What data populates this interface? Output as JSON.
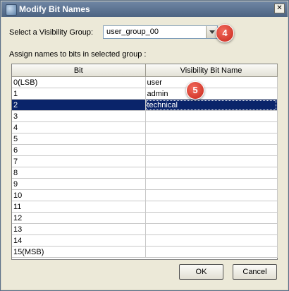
{
  "window": {
    "title": "Modify Bit Names",
    "close_glyph": "✕"
  },
  "group": {
    "label": "Select a Visibility Group:",
    "selected": "user_group_00"
  },
  "assign_label": "Assign names to bits in selected group :",
  "table": {
    "columns": [
      "Bit",
      "Visibility Bit Name"
    ],
    "rows": [
      {
        "bit": "0(LSB)",
        "name": "user"
      },
      {
        "bit": "1",
        "name": "admin"
      },
      {
        "bit": "2",
        "name": "technical"
      },
      {
        "bit": "3",
        "name": ""
      },
      {
        "bit": "4",
        "name": ""
      },
      {
        "bit": "5",
        "name": ""
      },
      {
        "bit": "6",
        "name": ""
      },
      {
        "bit": "7",
        "name": ""
      },
      {
        "bit": "8",
        "name": ""
      },
      {
        "bit": "9",
        "name": ""
      },
      {
        "bit": "10",
        "name": ""
      },
      {
        "bit": "11",
        "name": ""
      },
      {
        "bit": "12",
        "name": ""
      },
      {
        "bit": "13",
        "name": ""
      },
      {
        "bit": "14",
        "name": ""
      },
      {
        "bit": "15(MSB)",
        "name": ""
      }
    ],
    "selected_row": "2"
  },
  "callouts": [
    "4",
    "5"
  ],
  "buttons": {
    "ok": "OK",
    "cancel": "Cancel"
  },
  "colors": {
    "selection": "#0a246a",
    "callout": "#d9362a"
  }
}
